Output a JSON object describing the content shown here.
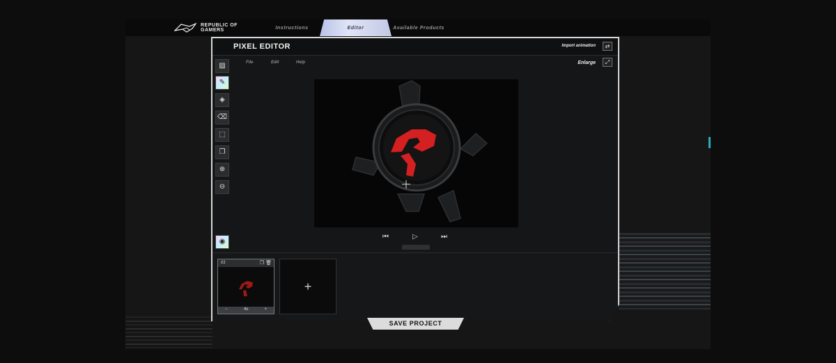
{
  "brand": {
    "logo_line1": "REPUBLIC OF",
    "logo_line2": "GAMERS"
  },
  "nav": {
    "tabs": [
      {
        "label": "Instructions",
        "active": false
      },
      {
        "label": "Editor",
        "active": true
      },
      {
        "label": "Available Products",
        "active": false
      }
    ]
  },
  "editor": {
    "title": "PIXEL EDITOR",
    "import_label": "Import animation",
    "enlarge_label": "Enlarge",
    "menu": [
      "File",
      "Edit",
      "Help"
    ],
    "tools": [
      "image-icon",
      "pencil-icon",
      "fill-icon",
      "eraser-icon",
      "select-icon",
      "copy-icon",
      "zoom-in-icon",
      "zoom-out-icon"
    ],
    "preview_tool": "eye-icon"
  },
  "frames": [
    {
      "number": "01",
      "duration": "4s",
      "minus": "−",
      "plus": "+"
    }
  ],
  "add_frame_label": "+",
  "save_label": "SAVE PROJECT",
  "colors": {
    "accent_gradient_start": "#b9c3e8",
    "pixel_red": "#e02020",
    "panel_border": "#d8d8d8"
  }
}
